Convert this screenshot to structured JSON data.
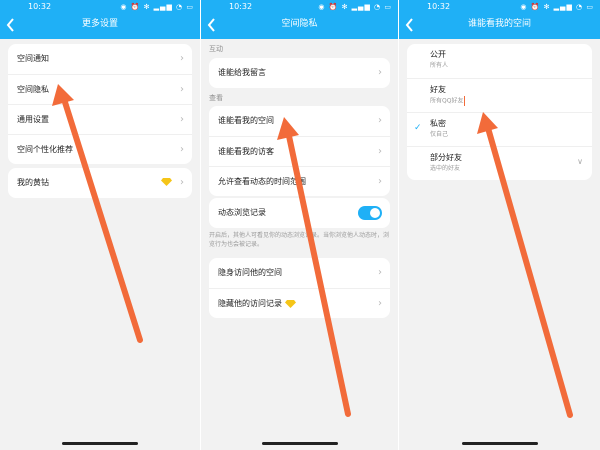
{
  "status": {
    "time": "10:32",
    "icons": "◉ ⏰ ✻ ▂▄▆ ◔ ▭"
  },
  "screen1": {
    "title": "更多设置",
    "group1": [
      "空间通知",
      "空间隐私",
      "通用设置",
      "空间个性化推荐"
    ],
    "group2": [
      "我的黄钻"
    ]
  },
  "screen2": {
    "title": "空间隐私",
    "section_interact": "互动",
    "interact_items": [
      "谁能给我留言"
    ],
    "section_view": "查看",
    "view_items": [
      "谁能看我的空间",
      "谁能看我的访客",
      "允许查看动态的时间范围"
    ],
    "toggle_label": "动态浏览记录",
    "toggle_on": true,
    "toggle_desc": "开启后，其他人可看见你的动态浏览记录。当你浏览他人动态时，浏览行为也会被记录。",
    "other_items": [
      "隐身访问他的空间",
      "隐藏他的访问记录"
    ]
  },
  "screen3": {
    "title": "谁能看我的空间",
    "options": [
      {
        "title": "公开",
        "sub": "所有人"
      },
      {
        "title": "好友",
        "sub": "所有QQ好友"
      },
      {
        "title": "私密",
        "sub": "仅自己"
      },
      {
        "title": "部分好友",
        "sub": "选中的好友"
      }
    ],
    "selected_index": 2
  },
  "icons": {
    "back": "chevron-left-icon",
    "chevron": "chevron-right-icon",
    "gem": "yellow-diamond-icon",
    "check": "check-icon"
  },
  "colors": {
    "accent": "#1fb0f6",
    "annotation_arrow": "#f26b3a",
    "gem": "#f5c518"
  }
}
